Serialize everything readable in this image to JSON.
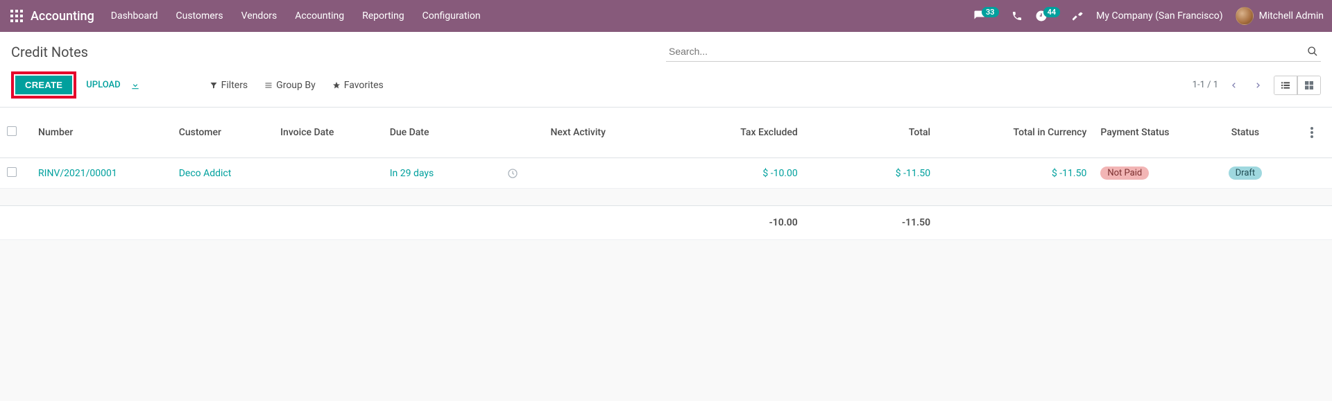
{
  "topnav": {
    "brand": "Accounting",
    "menu": [
      "Dashboard",
      "Customers",
      "Vendors",
      "Accounting",
      "Reporting",
      "Configuration"
    ],
    "messages_badge": "33",
    "activities_badge": "44",
    "company": "My Company (San Francisco)",
    "user": "Mitchell Admin"
  },
  "breadcrumb": {
    "title": "Credit Notes"
  },
  "toolbar": {
    "create_label": "CREATE",
    "upload_label": "UPLOAD"
  },
  "search": {
    "placeholder": "Search...",
    "filters_label": "Filters",
    "groupby_label": "Group By",
    "favorites_label": "Favorites"
  },
  "pager": {
    "text": "1-1 / 1"
  },
  "columns": {
    "number": "Number",
    "customer": "Customer",
    "invoice_date": "Invoice Date",
    "due_date": "Due Date",
    "next_activity": "Next Activity",
    "tax_excluded": "Tax Excluded",
    "total": "Total",
    "total_in_currency": "Total in Currency",
    "payment_status": "Payment Status",
    "status": "Status"
  },
  "rows": [
    {
      "number": "RINV/2021/00001",
      "customer": "Deco Addict",
      "invoice_date": "",
      "due_date": "In 29 days",
      "next_activity": "",
      "tax_excluded": "$ -10.00",
      "total": "$ -11.50",
      "total_in_currency": "$ -11.50",
      "payment_status": "Not Paid",
      "status": "Draft"
    }
  ],
  "footer": {
    "tax_excluded": "-10.00",
    "total": "-11.50"
  }
}
